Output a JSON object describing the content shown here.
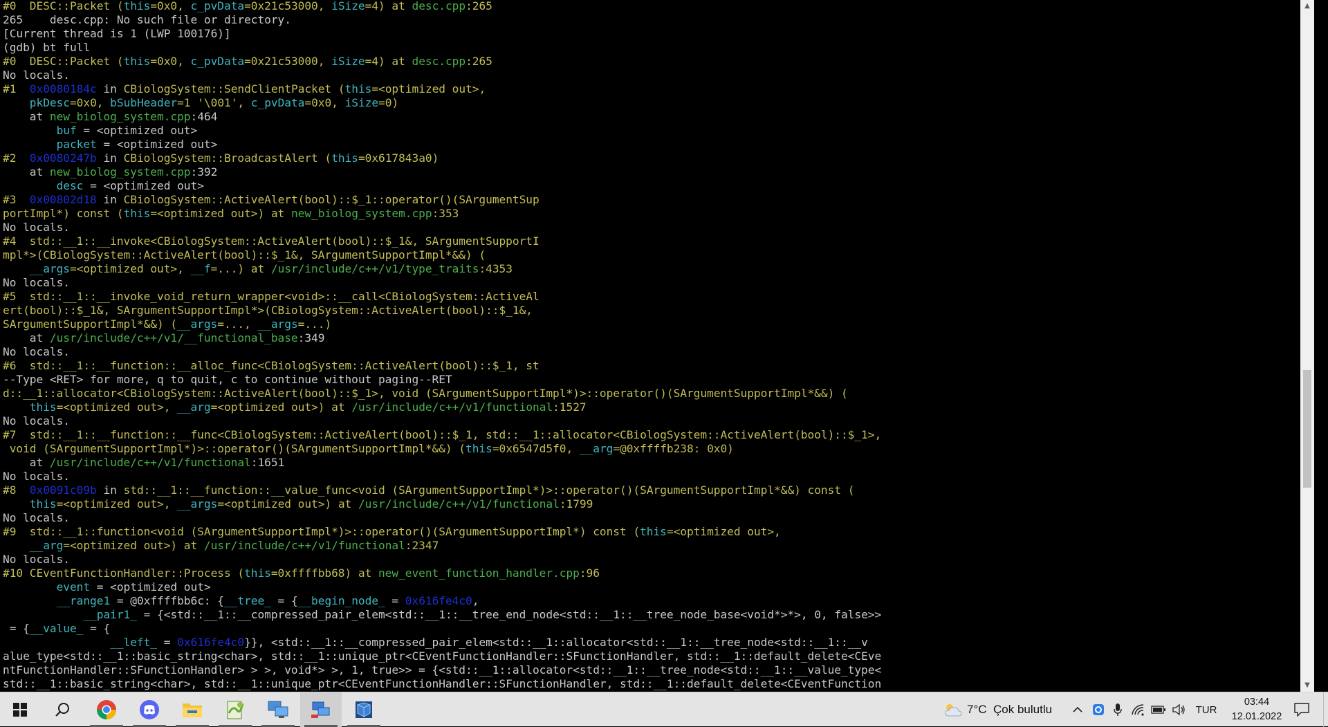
{
  "terminal": {
    "lines": [
      [
        [
          "y",
          "#0  DESC::Packet ("
        ],
        [
          "c",
          "this"
        ],
        [
          "y",
          "=0x0, "
        ],
        [
          "c",
          "c_pvData"
        ],
        [
          "y",
          "=0x21c53000, "
        ],
        [
          "c",
          "iSize"
        ],
        [
          "y",
          "=4) at "
        ],
        [
          "g",
          "desc.cpp"
        ],
        [
          "y",
          ":265"
        ]
      ],
      [
        [
          "w",
          "265\tdesc.cpp: No such file or directory."
        ]
      ],
      [
        [
          "w",
          "[Current thread is 1 (LWP 100176)]"
        ]
      ],
      [
        [
          "w",
          "(gdb) bt full"
        ]
      ],
      [
        [
          "y",
          "#0  DESC::Packet ("
        ],
        [
          "c",
          "this"
        ],
        [
          "y",
          "=0x0, "
        ],
        [
          "c",
          "c_pvData"
        ],
        [
          "y",
          "=0x21c53000, "
        ],
        [
          "c",
          "iSize"
        ],
        [
          "y",
          "=4) at "
        ],
        [
          "g",
          "desc.cpp"
        ],
        [
          "y",
          ":265"
        ]
      ],
      [
        [
          "w",
          "No locals."
        ]
      ],
      [
        [
          "y",
          "#1  "
        ],
        [
          "b",
          "0x0080184c"
        ],
        [
          "w",
          " in "
        ],
        [
          "y",
          "CBiologSystem::SendClientPacket ("
        ],
        [
          "c",
          "this"
        ],
        [
          "y",
          "=<optimized out>,"
        ]
      ],
      [
        [
          "y",
          "    "
        ],
        [
          "c",
          "pkDesc"
        ],
        [
          "y",
          "=0x0, "
        ],
        [
          "c",
          "bSubHeader"
        ],
        [
          "y",
          "=1 '\\001', "
        ],
        [
          "c",
          "c_pvData"
        ],
        [
          "y",
          "=0x0, "
        ],
        [
          "c",
          "iSize"
        ],
        [
          "y",
          "=0)"
        ]
      ],
      [
        [
          "w",
          "    at "
        ],
        [
          "g",
          "new_biolog_system.cpp"
        ],
        [
          "w",
          ":464"
        ]
      ],
      [
        [
          "w",
          "        "
        ],
        [
          "c",
          "buf"
        ],
        [
          "w",
          " = <optimized out>"
        ]
      ],
      [
        [
          "w",
          "        "
        ],
        [
          "c",
          "packet"
        ],
        [
          "w",
          " = <optimized out>"
        ]
      ],
      [
        [
          "y",
          "#2  "
        ],
        [
          "b",
          "0x0080247b"
        ],
        [
          "w",
          " in "
        ],
        [
          "y",
          "CBiologSystem::BroadcastAlert ("
        ],
        [
          "c",
          "this"
        ],
        [
          "y",
          "=0x617843a0)"
        ]
      ],
      [
        [
          "w",
          "    at "
        ],
        [
          "g",
          "new_biolog_system.cpp"
        ],
        [
          "w",
          ":392"
        ]
      ],
      [
        [
          "w",
          "        "
        ],
        [
          "c",
          "desc"
        ],
        [
          "w",
          " = <optimized out>"
        ]
      ],
      [
        [
          "y",
          "#3  "
        ],
        [
          "b",
          "0x00802d18"
        ],
        [
          "w",
          " in "
        ],
        [
          "y",
          "CBiologSystem::ActiveAlert(bool)::$_1::operator()(SArgumentSup"
        ]
      ],
      [
        [
          "y",
          "portImpl*) const ("
        ],
        [
          "c",
          "this"
        ],
        [
          "y",
          "=<optimized out>) at "
        ],
        [
          "g",
          "new_biolog_system.cpp"
        ],
        [
          "y",
          ":353"
        ]
      ],
      [
        [
          "w",
          "No locals."
        ]
      ],
      [
        [
          "y",
          "#4  std::__1::__invoke<CBiologSystem::ActiveAlert(bool)::$_1&, SArgumentSupportI"
        ]
      ],
      [
        [
          "y",
          "mpl*>(CBiologSystem::ActiveAlert(bool)::$_1&, SArgumentSupportImpl*&&) ("
        ]
      ],
      [
        [
          "y",
          "    "
        ],
        [
          "c",
          "__args"
        ],
        [
          "y",
          "=<optimized out>, "
        ],
        [
          "c",
          "__f"
        ],
        [
          "y",
          "=...) at "
        ],
        [
          "g",
          "/usr/include/c++/v1/type_traits"
        ],
        [
          "y",
          ":4353"
        ]
      ],
      [
        [
          "w",
          "No locals."
        ]
      ],
      [
        [
          "y",
          "#5  std::__1::__invoke_void_return_wrapper<void>::__call<CBiologSystem::ActiveAl"
        ]
      ],
      [
        [
          "y",
          "ert(bool)::$_1&, SArgumentSupportImpl*>(CBiologSystem::ActiveAlert(bool)::$_1&,"
        ]
      ],
      [
        [
          "y",
          "SArgumentSupportImpl*&&) ("
        ],
        [
          "c",
          "__args"
        ],
        [
          "y",
          "=..., "
        ],
        [
          "c",
          "__args"
        ],
        [
          "y",
          "=...)"
        ]
      ],
      [
        [
          "w",
          "    at "
        ],
        [
          "g",
          "/usr/include/c++/v1/__functional_base"
        ],
        [
          "w",
          ":349"
        ]
      ],
      [
        [
          "w",
          "No locals."
        ]
      ],
      [
        [
          "y",
          "#6  std::__1::__function::__alloc_func<CBiologSystem::ActiveAlert(bool)::$_1, st"
        ]
      ],
      [
        [
          "w",
          "--Type <RET> for more, q to quit, c to continue without paging--RET"
        ]
      ],
      [
        [
          "y",
          "d::__1::allocator<CBiologSystem::ActiveAlert(bool)::$_1>, void (SArgumentSupportImpl*)>::operator()(SArgumentSupportImpl*&&) ("
        ]
      ],
      [
        [
          "y",
          "    "
        ],
        [
          "c",
          "this"
        ],
        [
          "y",
          "=<optimized out>, "
        ],
        [
          "c",
          "__arg"
        ],
        [
          "y",
          "=<optimized out>) at "
        ],
        [
          "g",
          "/usr/include/c++/v1/functional"
        ],
        [
          "y",
          ":1527"
        ]
      ],
      [
        [
          "w",
          "No locals."
        ]
      ],
      [
        [
          "y",
          "#7  std::__1::__function::__func<CBiologSystem::ActiveAlert(bool)::$_1, std::__1::allocator<CBiologSystem::ActiveAlert(bool)::$_1>,"
        ]
      ],
      [
        [
          "y",
          " void (SArgumentSupportImpl*)>::operator()(SArgumentSupportImpl*&&) ("
        ],
        [
          "c",
          "this"
        ],
        [
          "y",
          "=0x6547d5f0, "
        ],
        [
          "c",
          "__arg"
        ],
        [
          "y",
          "=@0xffffb238: 0x0)"
        ]
      ],
      [
        [
          "w",
          "    at "
        ],
        [
          "g",
          "/usr/include/c++/v1/functional"
        ],
        [
          "w",
          ":1651"
        ]
      ],
      [
        [
          "w",
          "No locals."
        ]
      ],
      [
        [
          "y",
          "#8  "
        ],
        [
          "b",
          "0x0091c09b"
        ],
        [
          "w",
          " in "
        ],
        [
          "y",
          "std::__1::__function::__value_func<void (SArgumentSupportImpl*)>::operator()(SArgumentSupportImpl*&&) const ("
        ]
      ],
      [
        [
          "y",
          "    "
        ],
        [
          "c",
          "this"
        ],
        [
          "y",
          "=<optimized out>, "
        ],
        [
          "c",
          "__args"
        ],
        [
          "y",
          "=<optimized out>) at "
        ],
        [
          "g",
          "/usr/include/c++/v1/functional"
        ],
        [
          "y",
          ":1799"
        ]
      ],
      [
        [
          "w",
          "No locals."
        ]
      ],
      [
        [
          "y",
          "#9  std::__1::function<void (SArgumentSupportImpl*)>::operator()(SArgumentSupportImpl*) const ("
        ],
        [
          "c",
          "this"
        ],
        [
          "y",
          "=<optimized out>,"
        ]
      ],
      [
        [
          "y",
          "    "
        ],
        [
          "c",
          "__arg"
        ],
        [
          "y",
          "=<optimized out>) at "
        ],
        [
          "g",
          "/usr/include/c++/v1/functional"
        ],
        [
          "y",
          ":2347"
        ]
      ],
      [
        [
          "w",
          "No locals."
        ]
      ],
      [
        [
          "y",
          "#10 CEventFunctionHandler::Process ("
        ],
        [
          "c",
          "this"
        ],
        [
          "y",
          "=0xffffbb68) at "
        ],
        [
          "g",
          "new_event_function_handler.cpp"
        ],
        [
          "y",
          ":96"
        ]
      ],
      [
        [
          "w",
          "        "
        ],
        [
          "c",
          "event"
        ],
        [
          "w",
          " = <optimized out>"
        ]
      ],
      [
        [
          "w",
          "        "
        ],
        [
          "c",
          "__range1"
        ],
        [
          "w",
          " = @0xffffbb6c: {"
        ],
        [
          "c",
          "__tree_"
        ],
        [
          "w",
          " = {"
        ],
        [
          "c",
          "__begin_node_"
        ],
        [
          "w",
          " = "
        ],
        [
          "b",
          "0x616fe4c0"
        ],
        [
          "w",
          ","
        ]
      ],
      [
        [
          "w",
          "            "
        ],
        [
          "c",
          "__pair1_"
        ],
        [
          "w",
          " = {<std::__1::__compressed_pair_elem<std::__1::__tree_end_node<std::__1::__tree_node_base<void*>*>, 0, false>>"
        ]
      ],
      [
        [
          "w",
          " = {"
        ],
        [
          "c",
          "__value_"
        ],
        [
          "w",
          " = {"
        ]
      ],
      [
        [
          "w",
          "                "
        ],
        [
          "c",
          "__left_"
        ],
        [
          "w",
          " = "
        ],
        [
          "b",
          "0x616fe4c0"
        ],
        [
          "w",
          "}}, <std::__1::__compressed_pair_elem<std::__1::allocator<std::__1::__tree_node<std::__1::__v"
        ]
      ],
      [
        [
          "w",
          "alue_type<std::__1::basic_string<char>, std::__1::unique_ptr<CEventFunctionHandler::SFunctionHandler, std::__1::default_delete<CEve"
        ]
      ],
      [
        [
          "w",
          "ntFunctionHandler::SFunctionHandler> > >, void*> >, 1, true>> = {<std::__1::allocator<std::__1::__tree_node<std::__1::__value_type<"
        ]
      ],
      [
        [
          "w",
          "std::__1::basic_string<char>, std::__1::unique_ptr<CEventFunctionHandler::SFunctionHandler, std::__1::default_delete<CEventFunction"
        ]
      ]
    ]
  },
  "taskbar": {
    "apps": [
      {
        "name": "start-icon",
        "active": false
      },
      {
        "name": "search-icon",
        "active": false
      },
      {
        "name": "chrome-icon",
        "active": true
      },
      {
        "name": "discord-icon",
        "active": true
      },
      {
        "name": "file-explorer-icon",
        "active": true
      },
      {
        "name": "notepadpp-icon",
        "active": true
      },
      {
        "name": "remote-desktop-icon",
        "active": true
      },
      {
        "name": "network-computer-icon",
        "active": true
      },
      {
        "name": "virtualbox-icon",
        "active": true
      }
    ],
    "weather": {
      "temp": "7°C",
      "condition": "Çok bulutlu"
    },
    "language": "TUR",
    "time": "03:44",
    "date": "12.01.2022"
  },
  "colors": {
    "terminal_bg": "#000000",
    "text_white": "#c8c8c8",
    "text_yellow": "#c2bd55",
    "text_cyan": "#3fb4be",
    "text_green": "#4cae4c",
    "text_blue": "#1c2fd0",
    "taskbar_bg": "#e4e4e4"
  }
}
